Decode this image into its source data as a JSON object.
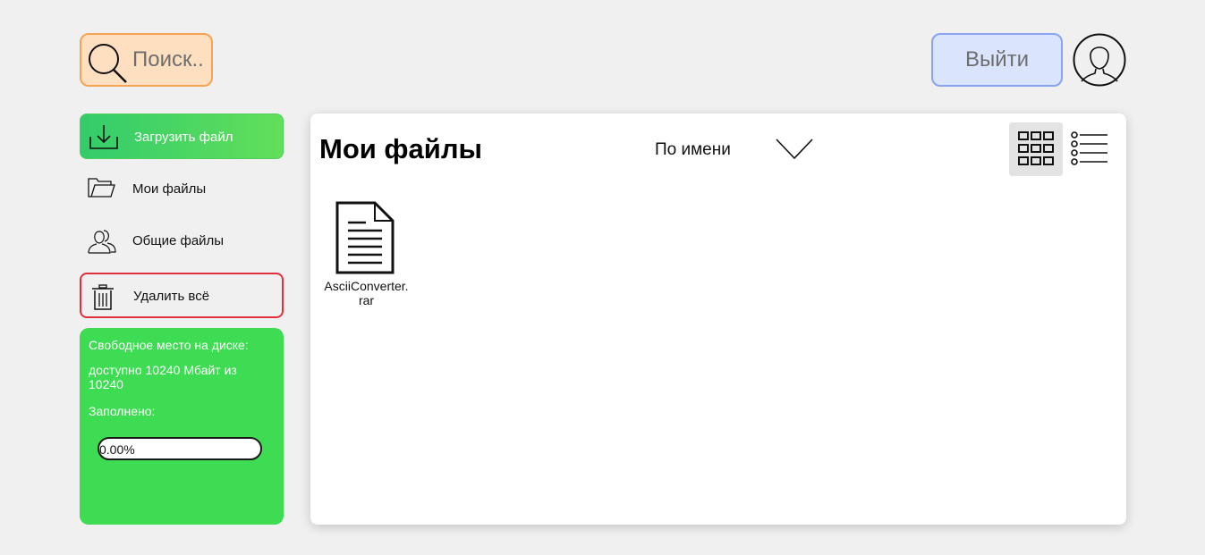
{
  "header": {
    "search_placeholder": "Поиск..",
    "logout_label": "Выйти"
  },
  "sidebar": {
    "items": [
      {
        "label": "Загрузить файл",
        "icon": "download-icon"
      },
      {
        "label": "Мои файлы",
        "icon": "folder-icon"
      },
      {
        "label": "Общие файлы",
        "icon": "users-icon"
      },
      {
        "label": "Удалить всё",
        "icon": "trash-icon"
      }
    ],
    "disk": {
      "title": "Свободное место на диске:",
      "available": "доступно 10240 Мбайт из 10240",
      "filled_label": "Заполнено:",
      "filled_percent_text": "0.00%",
      "filled_fraction": 0.0
    }
  },
  "main": {
    "title": "Мои файлы",
    "sort_label": "По имени",
    "files": [
      {
        "name": "AsciiConverter.rar",
        "icon": "document-icon"
      }
    ]
  },
  "colors": {
    "accent_green": "#3ddc52",
    "delete_red": "#e0303b",
    "search_orange": "#f6a453",
    "logout_blue": "#88a4f2"
  }
}
